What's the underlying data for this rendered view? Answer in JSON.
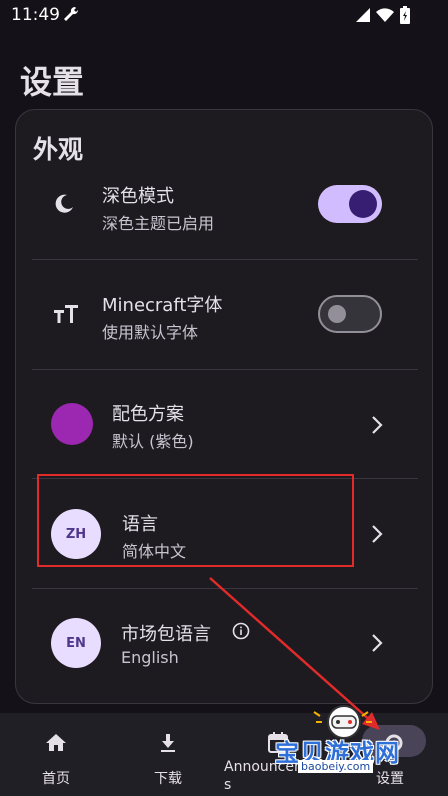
{
  "status_bar": {
    "time": "11:49"
  },
  "page": {
    "title": "设置"
  },
  "appearance": {
    "section_title": "外观",
    "dark_mode": {
      "title": "深色模式",
      "subtitle": "深色主题已启用",
      "enabled": true
    },
    "minecraft_font": {
      "title": "Minecraft字体",
      "subtitle": "使用默认字体",
      "enabled": false
    },
    "color_scheme": {
      "title": "配色方案",
      "subtitle": "默认 (紫色)",
      "swatch_color": "#9c27b0"
    },
    "language": {
      "title": "语言",
      "subtitle": "简体中文",
      "badge": "ZH"
    },
    "market_language": {
      "title": "市场包语言",
      "subtitle": "English",
      "badge": "EN"
    }
  },
  "bottom_nav": {
    "items": [
      {
        "label": "首页",
        "icon": "home-icon"
      },
      {
        "label": "下载",
        "icon": "download-icon"
      },
      {
        "label_line1": "Announcement",
        "label_line2": "s",
        "icon": "announcement-icon"
      },
      {
        "label": "设置",
        "icon": "settings-icon"
      }
    ]
  },
  "watermark": {
    "text": "宝贝游戏网",
    "url": "baobeiy.com"
  },
  "colors": {
    "accent": "#d0bcff",
    "highlight": "#e12b2b",
    "background": "#141218"
  }
}
